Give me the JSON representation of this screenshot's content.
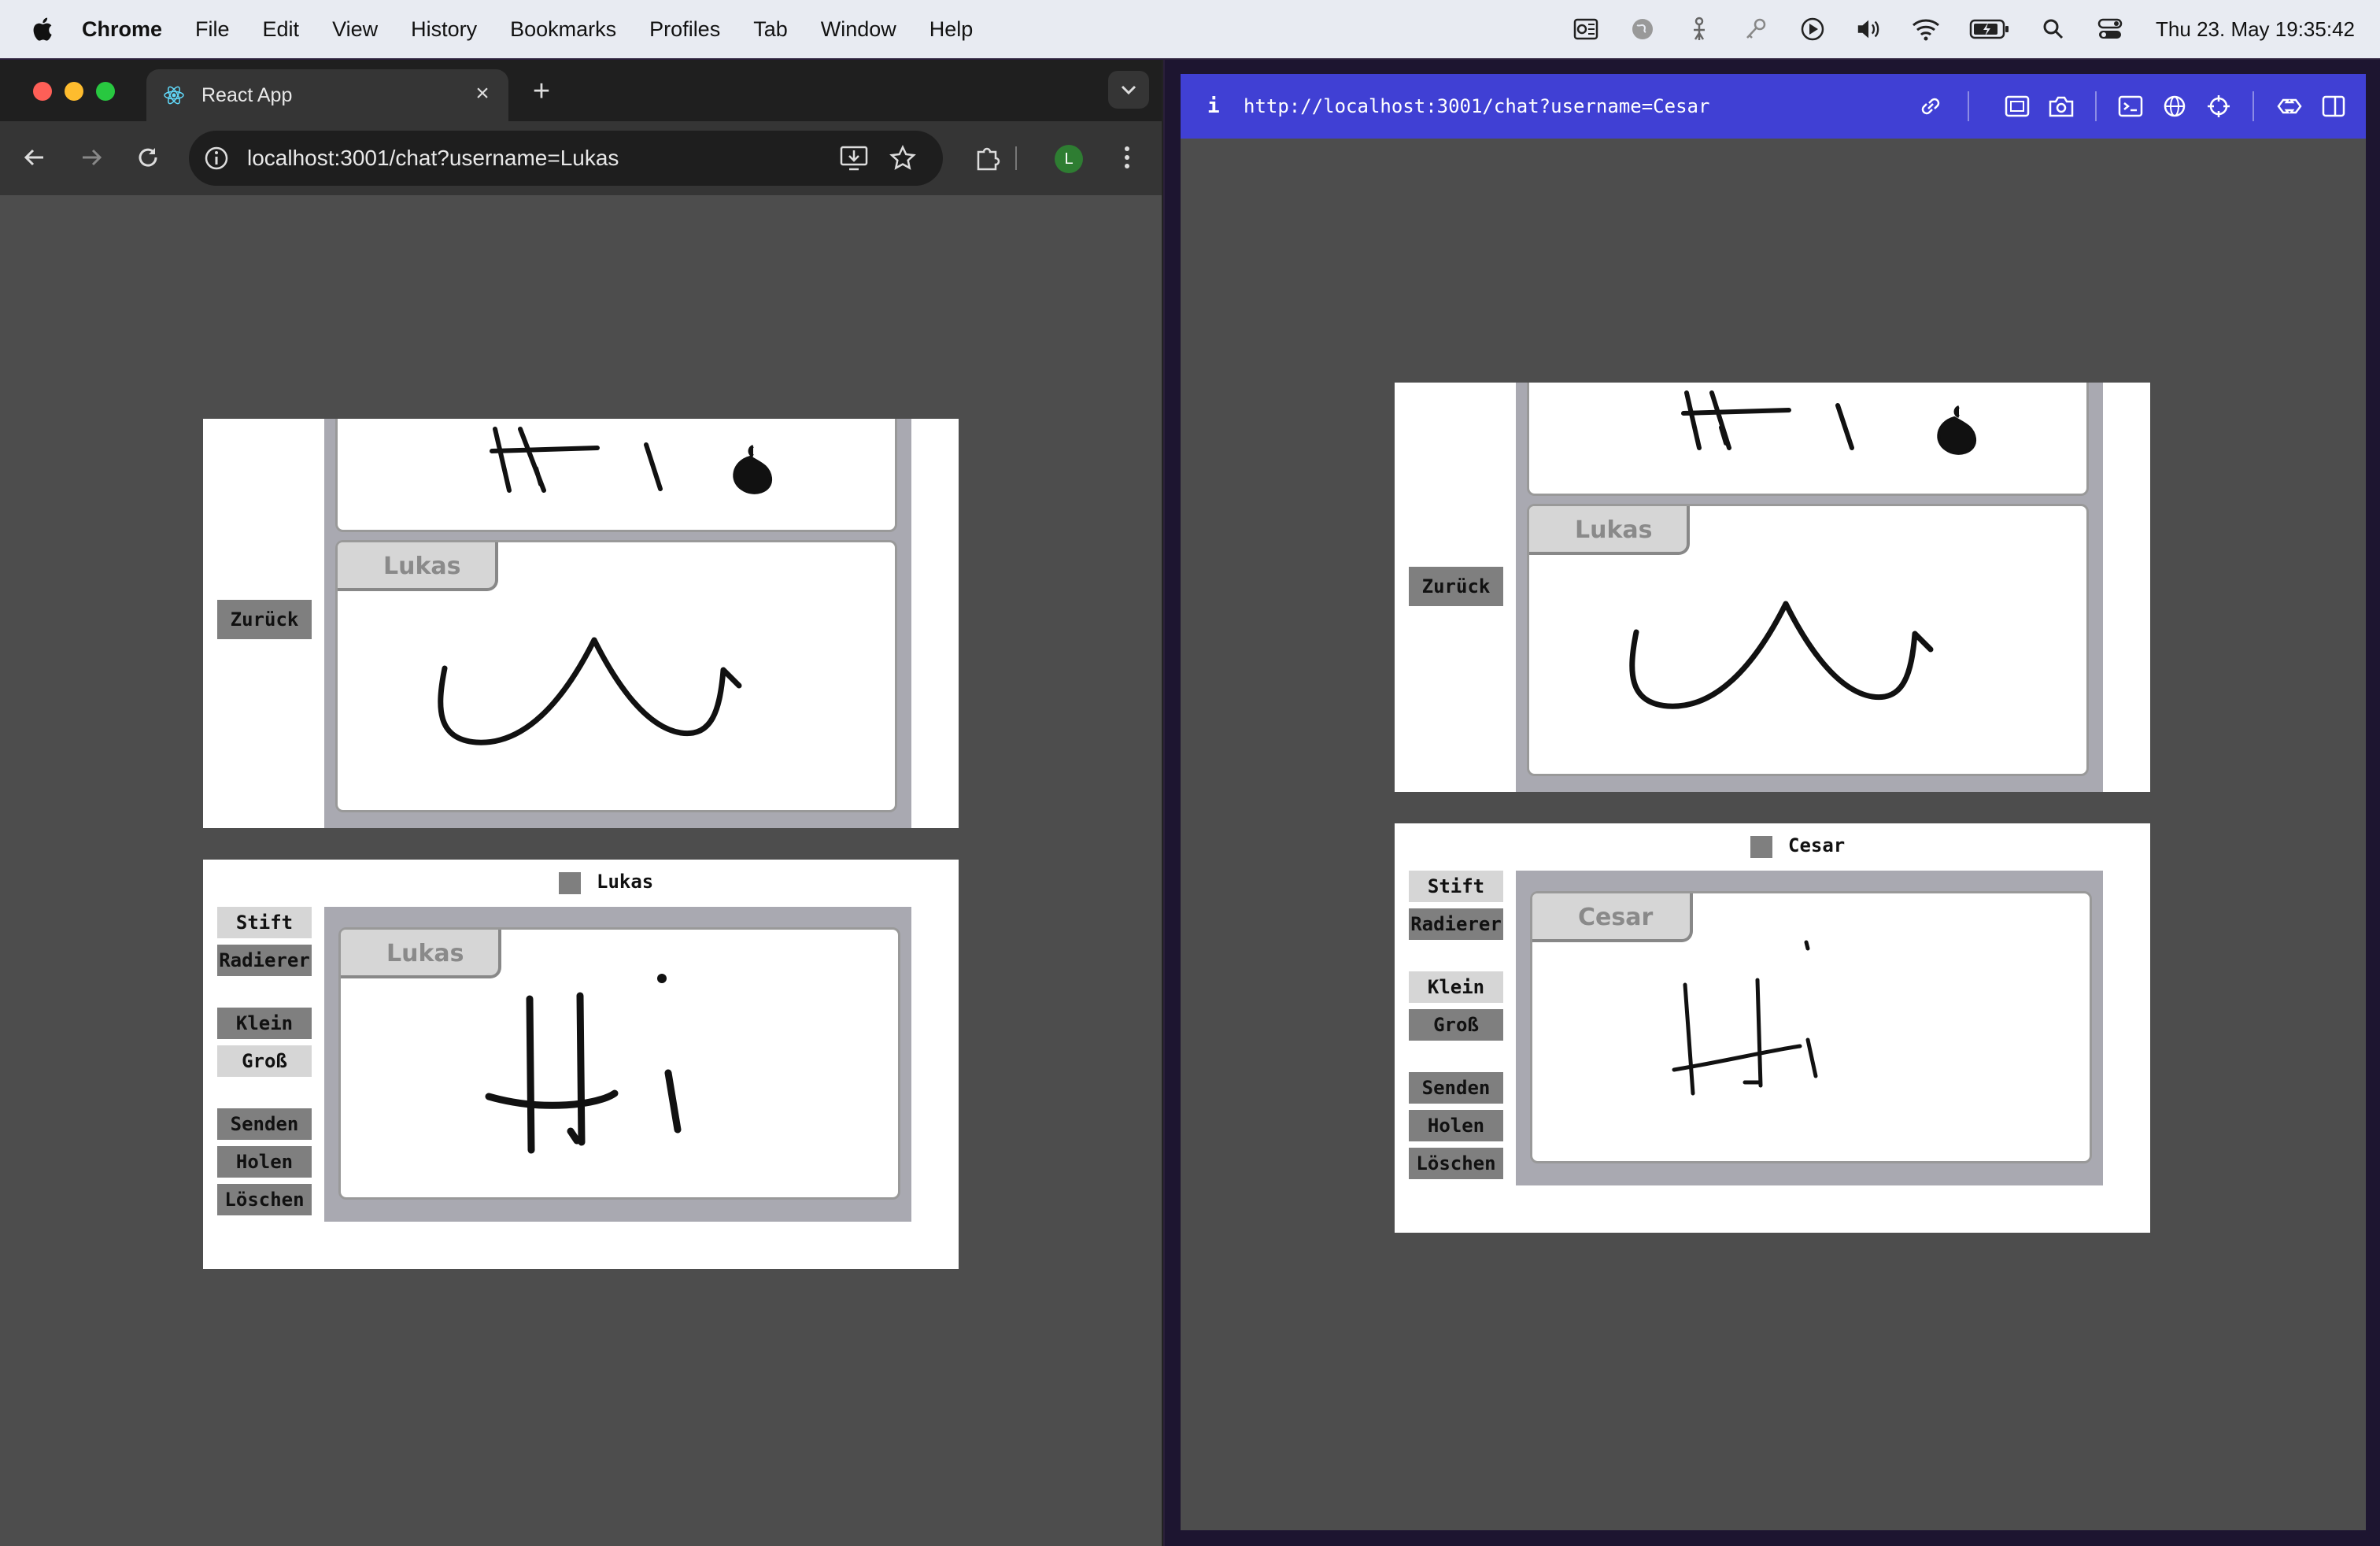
{
  "menubar": {
    "app": "Chrome",
    "items": [
      "File",
      "Edit",
      "View",
      "History",
      "Bookmarks",
      "Profiles",
      "Tab",
      "Window",
      "Help"
    ],
    "clock": "Thu 23. May  19:35:42"
  },
  "left_window": {
    "tab_title": "React App",
    "url": "localhost:3001/chat?username=Lukas",
    "profile_initial": "L",
    "app": {
      "back_button": "Zurück",
      "history_author": "Lukas",
      "compose_user": "Lukas",
      "compose_author": "Lukas",
      "tools": {
        "pen": "Stift",
        "eraser": "Radierer",
        "small": "Klein",
        "large": "Groß",
        "send": "Senden",
        "fetch": "Holen",
        "delete": "Löschen"
      }
    }
  },
  "right_window": {
    "info": "i",
    "url": "http://localhost:3001/chat?username=Cesar",
    "app": {
      "back_button": "Zurück",
      "history_author": "Lukas",
      "compose_user": "Cesar",
      "compose_author": "Cesar",
      "tools": {
        "pen": "Stift",
        "eraser": "Radierer",
        "small": "Klein",
        "large": "Groß",
        "send": "Senden",
        "fetch": "Holen",
        "delete": "Löschen"
      }
    }
  }
}
